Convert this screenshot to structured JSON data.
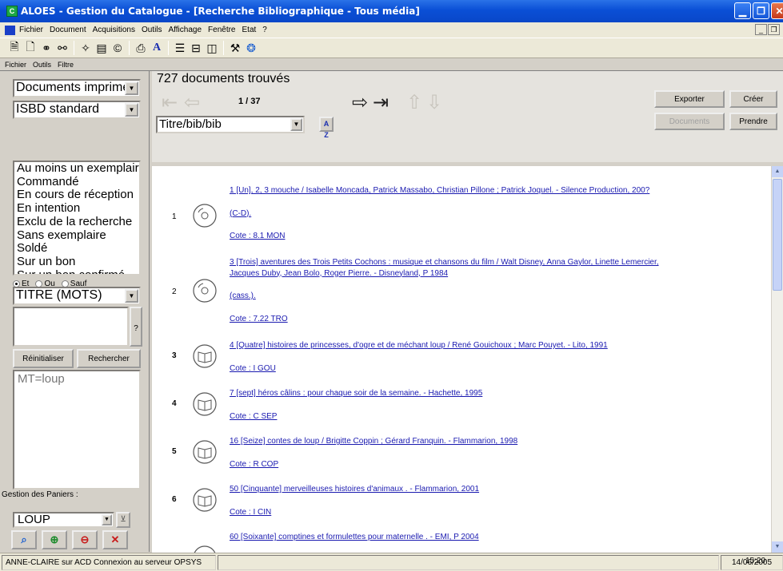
{
  "window": {
    "app_icon": "C",
    "title": "ALOES - Gestion du Catalogue - [Recherche Bibliographique - Tous média]",
    "buttons": [
      "minimize-icon",
      "restore-icon",
      "close-icon"
    ]
  },
  "menubar": {
    "items": [
      "Fichier",
      "Document",
      "Acquisitions",
      "Outils",
      "Affichage",
      "Fenêtre",
      "Etat",
      "?"
    ]
  },
  "toolbar": {
    "icons": [
      "new-record-icon",
      "open-record-icon",
      "binoculars-icon",
      "binoculars-search-icon",
      "catalog-icon",
      "list-icon",
      "copyright-icon",
      "print-icon",
      "font-a-icon",
      "tree-icon",
      "layout-icon",
      "frame-icon",
      "tools-icon",
      "web-icon"
    ]
  },
  "submenubar": {
    "items": [
      "Fichier",
      "Outils",
      "Filtre"
    ]
  },
  "left": {
    "media_combo": "Documents imprimés",
    "format_combo": "ISBD standard",
    "status_list": [
      "Au moins un exemplaire",
      "Commandé",
      "En cours de réception",
      "En intention",
      "Exclu de la recherche",
      "Sans exemplaire",
      "Soldé",
      "Sur un bon",
      "Sur un bon confirmé"
    ],
    "operators": [
      "Et",
      "Ou",
      "Sauf"
    ],
    "operator_selected": "Et",
    "index_combo": "TITRE (MOTS)",
    "search_input": "",
    "help_button": "?",
    "reset_button": "Réinitialiser",
    "search_button": "Rechercher",
    "criteria": "MT=loup",
    "basket_label": "Gestion des Paniers :",
    "basket_combo": "LOUP",
    "basket_buttons": [
      "magnify-icon",
      "basket-add-icon",
      "basket-remove-icon",
      "delete-icon"
    ]
  },
  "header": {
    "count": "727 documents trouvés",
    "pager": "1 / 37",
    "sort_combo": "Titre/bib/bib",
    "sort_icon": "A Z",
    "export_button": "Exporter",
    "create_button": "Créer",
    "documents_button": "Documents",
    "take_button": "Prendre"
  },
  "results": [
    {
      "number": "1",
      "media": "cd",
      "bold": false,
      "lines": [
        "1 [Un], 2, 3 mouche / Isabelle Moncada, Patrick Massabo, Christian Pillone ; Patrick Joquel. - Silence Production, 200?"
      ],
      "title": "1 [Un], 2, 3 mouche",
      "support": "(C-D).",
      "cote": "Cote : 8.1 MON"
    },
    {
      "number": "2",
      "media": "cd",
      "bold": false,
      "lines": [
        "3 [Trois] aventures des Trois Petits Cochons : musique et chansons du film / Walt Disney, Anna Gaylor, Linette Lemercier,",
        "Jacques Duby, Jean Bolo, Roger Pierre. - Disneyland, P 1984"
      ],
      "title": "3 [Trois] aventures des Trois Petits Cochons",
      "support": "(cass.).",
      "cote": "Cote : 7.22 TRO"
    },
    {
      "number": "3",
      "media": "book",
      "bold": true,
      "lines": [
        "4 [Quatre] histoires de princesses, d'ogre et de méchant loup / René Gouichoux ; Marc Pouyet. - Lito, 1991"
      ],
      "cote": "Cote : I GOU"
    },
    {
      "number": "4",
      "media": "book",
      "bold": true,
      "lines": [
        "7 [sept] héros câlins : pour chaque soir de la semaine. - Hachette, 1995"
      ],
      "cote": "Cote : C SEP"
    },
    {
      "number": "5",
      "media": "book",
      "bold": true,
      "lines": [
        "16 [Seize] contes de loup / Brigitte Coppin ; Gérard Franquin. - Flammarion, 1998"
      ],
      "cote": "Cote : R COP"
    },
    {
      "number": "6",
      "media": "book",
      "bold": true,
      "lines": [
        "50 [Cinquante] merveilleuses histoires d'animaux . - Flammarion, 2001"
      ],
      "cote": "Cote : I CIN"
    },
    {
      "number": "",
      "media": "book",
      "bold": true,
      "lines": [
        "60 [Soixante] comptines et formulettes pour maternelle . - EMI, P 2004"
      ],
      "cote": ""
    }
  ],
  "statusbar": {
    "connection": "ANNE-CLAIRE sur ACD Connexion au serveur OPSYS",
    "date": "14/06/2005",
    "time": "15:20"
  }
}
